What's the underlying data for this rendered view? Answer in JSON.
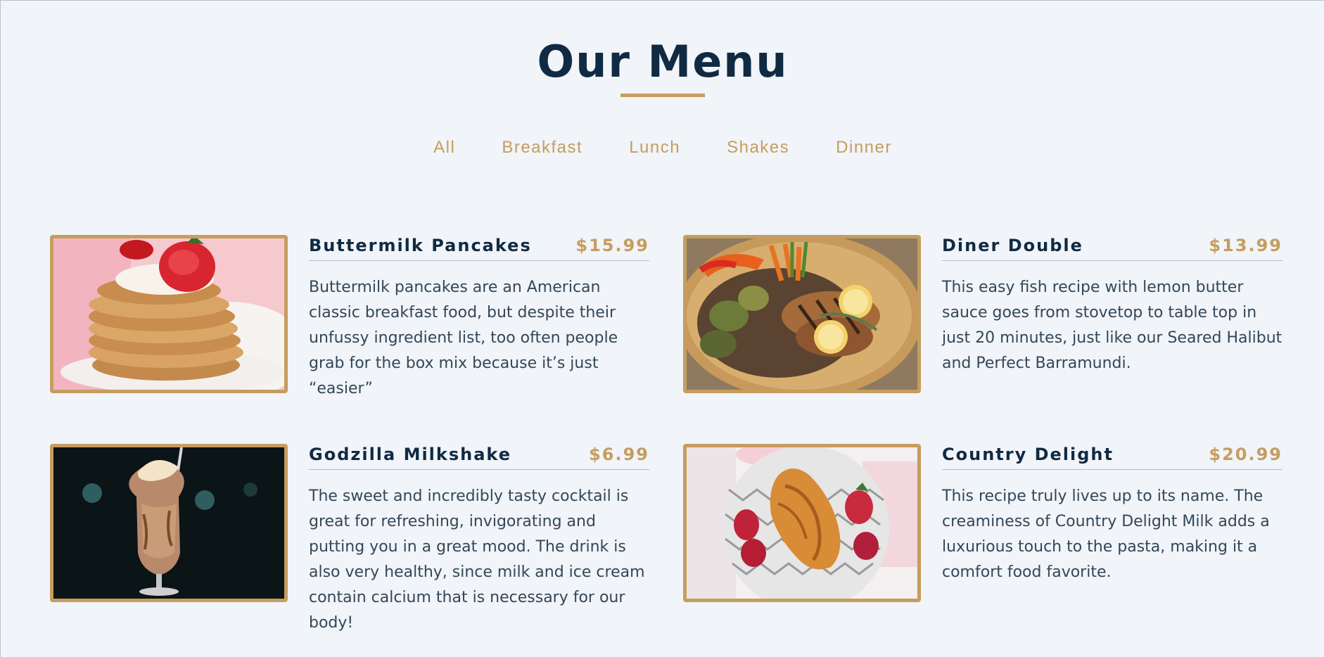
{
  "header": {
    "title": "Our Menu"
  },
  "filters": [
    {
      "label": "All"
    },
    {
      "label": "Breakfast"
    },
    {
      "label": "Lunch"
    },
    {
      "label": "Shakes"
    },
    {
      "label": "Dinner"
    }
  ],
  "colors": {
    "accent": "#c59d5f",
    "heading": "#102a43",
    "background": "#f1f4f8"
  },
  "items": [
    {
      "name": "Buttermilk Pancakes",
      "price": "$15.99",
      "description": "Buttermilk pancakes are an American classic breakfast food, but despite their unfussy ingredient list, too often people grab for the box mix because it’s just “easier”",
      "image": "pancakes-photo"
    },
    {
      "name": "Diner Double",
      "price": "$13.99",
      "description": "This easy fish recipe with lemon butter sauce goes from stovetop to table top in just 20 minutes, just like our Seared Halibut and Perfect Barramundi.",
      "image": "grilled-fish-plate-photo"
    },
    {
      "name": "Godzilla Milkshake",
      "price": "$6.99",
      "description": "The sweet and incredibly tasty cocktail is great for refreshing, invigorating and putting you in a great mood. The drink is also very healthy, since milk and ice cream contain calcium that is necessary for our body!",
      "image": "milkshake-photo"
    },
    {
      "name": "Country Delight",
      "price": "$20.99",
      "description": "This recipe truly lives up to its name. The creaminess of Country Delight Milk adds a luxurious touch to the pasta, making it a comfort food favorite.",
      "image": "croissant-strawberries-photo"
    }
  ]
}
